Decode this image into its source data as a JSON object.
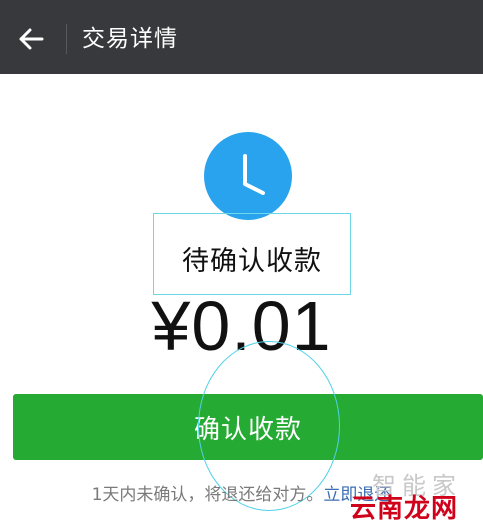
{
  "header": {
    "back_icon": "arrow-left-icon",
    "title": "交易详情"
  },
  "status": {
    "icon": "clock-icon",
    "label": "待确认收款"
  },
  "amount": "¥0.01",
  "confirm_button": {
    "label": "确认收款"
  },
  "hint": {
    "text": "1天内未确认，将退还给对方。",
    "link": "立即退还"
  },
  "watermarks": {
    "site_a": "智能家",
    "site_b": "云南龙网"
  },
  "colors": {
    "topbar": "#37393d",
    "clock": "#2aa3ee",
    "button": "#25aa34",
    "link": "#3d6db3",
    "watermark_red": "#d0021b"
  }
}
